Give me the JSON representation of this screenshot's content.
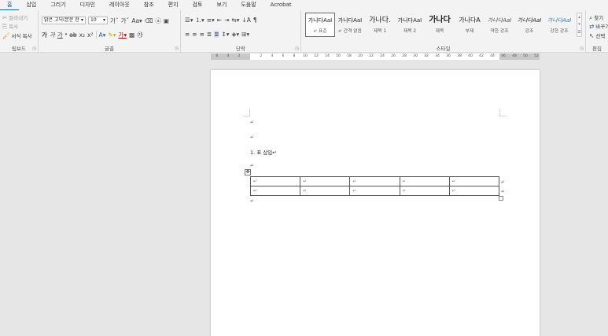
{
  "menu": {
    "items": [
      {
        "label": "홈",
        "active": true
      },
      {
        "label": "삽입"
      },
      {
        "label": "그리기"
      },
      {
        "label": "디자인"
      },
      {
        "label": "레이아웃"
      },
      {
        "label": "참조"
      },
      {
        "label": "편지"
      },
      {
        "label": "검토"
      },
      {
        "label": "보기"
      },
      {
        "label": "도움말"
      },
      {
        "label": "Acrobat"
      }
    ]
  },
  "clipboard": {
    "cut": "잘라내기",
    "copy": "복사",
    "format_painter": "서식 복사",
    "label": "립보드"
  },
  "font": {
    "family": "맑은 고딕(본문 한",
    "size": "10",
    "label": "글꼴"
  },
  "paragraph": {
    "label": "단락"
  },
  "styles": {
    "label": "스타일",
    "items": [
      {
        "preview": "가나다AaI",
        "name": "↵ 표준",
        "selected": true
      },
      {
        "preview": "가나다AaI",
        "name": "↵ 간격 없음"
      },
      {
        "preview": "가나다.",
        "name": "제목 1"
      },
      {
        "preview": "가나다AaI",
        "name": "제목 2"
      },
      {
        "preview": "가나다",
        "name": "제목"
      },
      {
        "preview": "가나다A",
        "name": "부제"
      },
      {
        "preview": "가나다AaI",
        "name": "약한 강조"
      },
      {
        "preview": "가나다AaI",
        "name": "강조"
      },
      {
        "preview": "가나다AaI",
        "name": "강한 강조"
      }
    ]
  },
  "editing": {
    "find": "찾기",
    "replace": "바꾸기",
    "select": "선택",
    "label": "편집"
  },
  "ruler": {
    "ticks": [
      "6",
      "4",
      "2",
      "",
      "2",
      "4",
      "6",
      "8",
      "10",
      "12",
      "14",
      "16",
      "18",
      "20",
      "22",
      "24",
      "26",
      "28",
      "30",
      "32",
      "34",
      "36",
      "38",
      "40",
      "42",
      "44",
      "46",
      "48",
      "50",
      "52"
    ]
  },
  "document": {
    "para_mark": "↵",
    "heading": "1. 표 삽입↵",
    "table_rows": [
      [
        "↵",
        "↵",
        "↵",
        "↵",
        "↵"
      ],
      [
        "↵",
        "↵",
        "↵",
        "↵",
        "↵"
      ]
    ],
    "table_move_icon": "✥"
  },
  "colors": {
    "accent": "#1a5fb4",
    "highlight": "#f2d600",
    "font_color": "#c00000"
  }
}
